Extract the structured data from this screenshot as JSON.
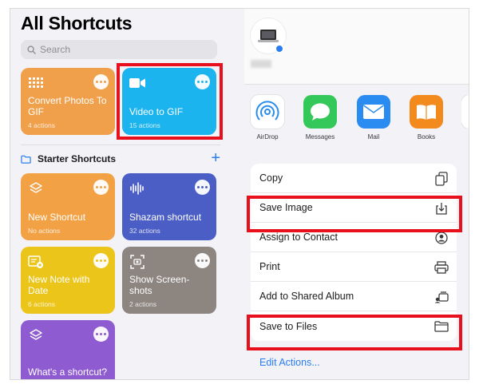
{
  "left_panel": {
    "title": "All Shortcuts",
    "search_placeholder": "Search",
    "top_shortcuts": [
      {
        "name": "Convert Photos To GIF",
        "sub": "4 actions",
        "color": "#f0a04b",
        "icon": "grid-icon"
      },
      {
        "name": "Video to GIF",
        "sub": "15 actions",
        "color": "#1cb4ee",
        "icon": "video-camera-icon"
      }
    ],
    "section": {
      "label": "Starter Shortcuts",
      "add_label": "+"
    },
    "starter_shortcuts": [
      {
        "name": "New Shortcut",
        "sub": "No actions",
        "color": "#f2a245",
        "icon": "layers-icon"
      },
      {
        "name": "Shazam shortcut",
        "sub": "32 actions",
        "color": "#4b5ec5",
        "icon": "waveform-icon"
      },
      {
        "name": "New Note with Date",
        "sub": "6 actions",
        "color": "#ebc51a",
        "icon": "note-add-icon"
      },
      {
        "name": "Show Screen-shots",
        "sub": "2 actions",
        "color": "#8c8580",
        "icon": "screenshot-icon"
      },
      {
        "name": "What's a shortcut?",
        "sub": "",
        "color": "#8f5bd0",
        "icon": "layers-icon"
      }
    ]
  },
  "share_sheet": {
    "apps": [
      {
        "label": "AirDrop",
        "icon": "airdrop-icon",
        "color": "#ffffff"
      },
      {
        "label": "Messages",
        "icon": "messages-icon",
        "color": "#34c759"
      },
      {
        "label": "Mail",
        "icon": "mail-icon",
        "color": "#2a8cf0"
      },
      {
        "label": "Books",
        "icon": "books-icon",
        "color": "#f28a1d"
      }
    ],
    "actions": [
      {
        "label": "Copy",
        "icon": "copy-icon"
      },
      {
        "label": "Save Image",
        "icon": "save-down-icon"
      },
      {
        "label": "Assign to Contact",
        "icon": "contact-icon"
      },
      {
        "label": "Print",
        "icon": "printer-icon"
      },
      {
        "label": "Add to Shared Album",
        "icon": "shared-album-icon"
      },
      {
        "label": "Save to Files",
        "icon": "folder-icon"
      }
    ],
    "edit_actions": "Edit Actions..."
  },
  "highlight_color": "#e8101c"
}
